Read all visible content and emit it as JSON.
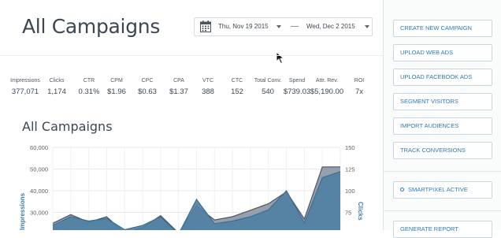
{
  "header": {
    "title": "All Campaigns",
    "date_start": "Thu, Nov 19 2015",
    "date_end": "Wed, Dec 2 2015",
    "date_separator": "—"
  },
  "stats": [
    {
      "label": "Impressions",
      "value": "377,071"
    },
    {
      "label": "Clicks",
      "value": "1,174"
    },
    {
      "label": "CTR",
      "value": "0.31%"
    },
    {
      "label": "CPM",
      "value": "$1.96"
    },
    {
      "label": "CPC",
      "value": "$0.63"
    },
    {
      "label": "CPA",
      "value": "$1.37"
    },
    {
      "label": "VTC",
      "value": "388"
    },
    {
      "label": "CTC",
      "value": "152"
    },
    {
      "label": "Total Conv.",
      "value": "540"
    },
    {
      "label": "Spend",
      "value": "$739.03"
    },
    {
      "label": "Attr. Rev.",
      "value": "$5,190.00"
    },
    {
      "label": "ROI",
      "value": "7x"
    }
  ],
  "sidebar": {
    "buttons": [
      "CREATE NEW CAMPAIGN",
      "UPLOAD WEB ADS",
      "UPLOAD FACEBOOK ADS",
      "SEGMENT VISITORS",
      "IMPORT AUDIENCES",
      "TRACK CONVERSIONS"
    ],
    "smartpixel": "SMARTPIXEL ACTIVE",
    "report": "GENERATE REPORT"
  },
  "colors": {
    "impressions_fill": "#8d98a5",
    "clicks_fill": "#4f7fa3",
    "button_text": "#2f7ab0",
    "title_text": "#3c4753"
  },
  "chart_data": {
    "type": "area",
    "title": "All Campaigns",
    "y_left_label": "Impressions",
    "y_right_label": "Clicks",
    "y_left_ticks": [
      "60,000",
      "50,000",
      "40,000",
      "30,000"
    ],
    "y_right_ticks": [
      "150",
      "125",
      "100",
      "75"
    ],
    "y_left_range": [
      0,
      60000
    ],
    "y_right_range": [
      0,
      150
    ],
    "x_tick_labels": [],
    "series": [
      {
        "name": "Impressions",
        "axis": "left",
        "values": [
          25000,
          29000,
          25500,
          28000,
          20500,
          23000,
          28500,
          20500,
          33000,
          26500,
          28000,
          31000,
          34000,
          39500,
          27000,
          51000,
          51000
        ]
      },
      {
        "name": "Clicks",
        "axis": "right",
        "values": [
          60,
          70,
          65,
          68,
          55,
          60,
          70,
          50,
          90,
          62,
          65,
          70,
          78,
          100,
          63,
          115,
          122
        ]
      }
    ],
    "grid": true
  }
}
